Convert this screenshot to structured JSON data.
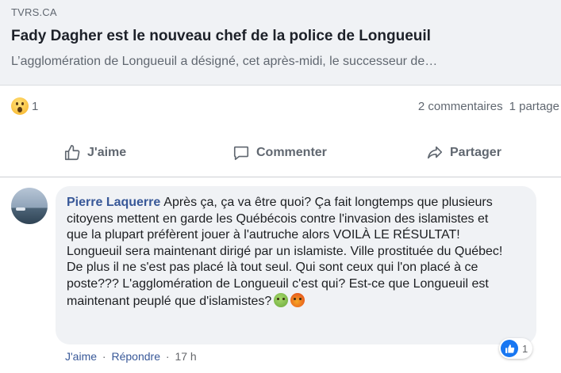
{
  "link_preview": {
    "domain": "TVRS.CA",
    "title": "Fady Dagher est le nouveau chef de la police de Longueuil",
    "description": "L’agglomération de Longueuil a désigné, cet après-midi, le successeur de…"
  },
  "stats": {
    "reaction_icon": "wow-emoji-icon",
    "reaction_count": "1",
    "comments": "2 commentaires",
    "shares": "1 partage"
  },
  "actions": {
    "like_label": "J'aime",
    "comment_label": "Commenter",
    "share_label": "Partager"
  },
  "comment": {
    "author": "Pierre Laquerre",
    "text": "Après ça, ça va être quoi? Ça fait longtemps que plusieurs citoyens mettent en garde les Québécois contre l'invasion des islamistes et que la plupart préfèrent jouer à l'autruche alors VOILÀ LE RÉSULTAT! Longueuil sera maintenant dirigé par un islamiste. Ville prostituée du Québec! De plus il ne s'est pas placé là tout seul. Qui sont ceux qui l'on placé à ce poste??? L'agglomération de Longueuil c'est qui? Est-ce que Longueuil est maintenant peuplé que d'islamistes?",
    "emojis": [
      "nauseated-face-icon",
      "angry-cursing-face-icon"
    ],
    "like_count": "1",
    "like_action": "J'aime",
    "reply_action": "Répondre",
    "separator": "·",
    "time": "17 h"
  },
  "colors": {
    "link_blue": "#385898",
    "like_blue": "#1877f2",
    "secondary_text": "#606770",
    "card_bg": "#f0f2f5"
  }
}
